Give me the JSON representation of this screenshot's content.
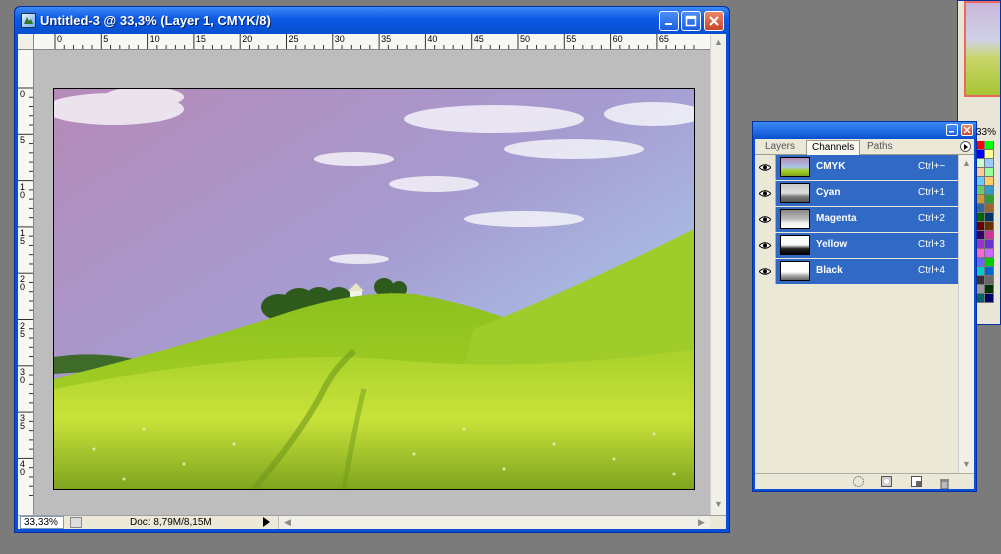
{
  "document": {
    "title": "Untitled-3 @ 33,3% (Layer 1, CMYK/8)",
    "ruler_top_labels": [
      "0",
      "5",
      "10",
      "15",
      "20",
      "25",
      "30",
      "35",
      "40",
      "45",
      "50",
      "55",
      "60",
      "65"
    ],
    "ruler_left_labels": [
      "0",
      "5",
      "10",
      "15",
      "20",
      "25",
      "30",
      "35",
      "40"
    ],
    "status": {
      "zoom": "33,33%",
      "doc_info": "Doc: 8,79M/8,15M"
    }
  },
  "swatches_window": {
    "zoom": "33%",
    "colors": [
      "#fe0000",
      "#00ff00",
      "#0000ff",
      "#ffff99",
      "#ccffcc",
      "#99ccff",
      "#ffcc99",
      "#99ff99",
      "#66ccff",
      "#ffcc66",
      "#66cc66",
      "#3399cc",
      "#cc9933",
      "#339933",
      "#336699",
      "#996633",
      "#006600",
      "#003366",
      "#660000",
      "#663300",
      "#330066",
      "#cc3399",
      "#9933cc",
      "#6633cc",
      "#ff66cc",
      "#cc66ff",
      "#6666ff",
      "#00cc00",
      "#00cccc",
      "#0066cc",
      "#333333",
      "#666666",
      "#999999",
      "#003300",
      "#006666",
      "#000066"
    ]
  },
  "channels_palette": {
    "tabs": [
      "Layers",
      "Channels",
      "Paths"
    ],
    "active_tab": "Channels",
    "channels": [
      {
        "name": "CMYK",
        "shortcut": "Ctrl+~"
      },
      {
        "name": "Cyan",
        "shortcut": "Ctrl+1"
      },
      {
        "name": "Magenta",
        "shortcut": "Ctrl+2"
      },
      {
        "name": "Yellow",
        "shortcut": "Ctrl+3"
      },
      {
        "name": "Black",
        "shortcut": "Ctrl+4"
      }
    ]
  }
}
